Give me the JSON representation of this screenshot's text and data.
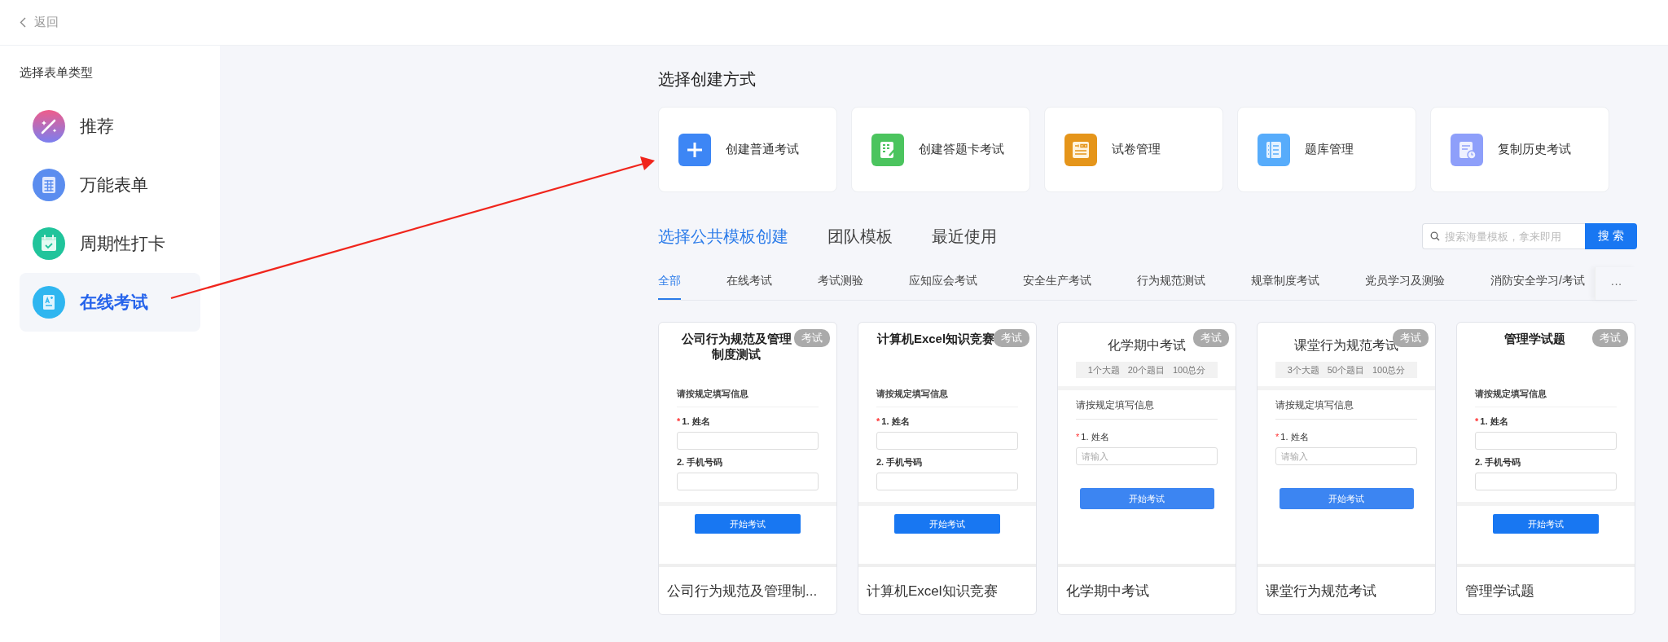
{
  "top_bar": {
    "back_label": "返回"
  },
  "sidebar": {
    "title": "选择表单类型",
    "items": [
      {
        "label": "推荐",
        "kind": "wand",
        "selected": false
      },
      {
        "label": "万能表单",
        "kind": "sheet",
        "selected": false
      },
      {
        "label": "周期性打卡",
        "kind": "calendar",
        "selected": false
      },
      {
        "label": "在线考试",
        "kind": "exam",
        "selected": true
      }
    ]
  },
  "create": {
    "title": "选择创建方式",
    "options": [
      {
        "label": "创建普通考试",
        "kind": "plus"
      },
      {
        "label": "创建答题卡考试",
        "kind": "card"
      },
      {
        "label": "试卷管理",
        "kind": "paper"
      },
      {
        "label": "题库管理",
        "kind": "bank"
      },
      {
        "label": "复制历史考试",
        "kind": "copy"
      }
    ]
  },
  "template_tabs": [
    {
      "label": "选择公共模板创建",
      "selected": true
    },
    {
      "label": "团队模板",
      "selected": false
    },
    {
      "label": "最近使用",
      "selected": false
    }
  ],
  "search": {
    "placeholder": "搜索海量模板，拿来即用",
    "button": "搜 索"
  },
  "categories": [
    {
      "label": "全部",
      "selected": true
    },
    {
      "label": "在线考试",
      "selected": false
    },
    {
      "label": "考试测验",
      "selected": false
    },
    {
      "label": "应知应会考试",
      "selected": false
    },
    {
      "label": "安全生产考试",
      "selected": false
    },
    {
      "label": "行为规范测试",
      "selected": false
    },
    {
      "label": "规章制度考试",
      "selected": false
    },
    {
      "label": "党员学习及测验",
      "selected": false
    },
    {
      "label": "消防安全学习/考试",
      "selected": false
    }
  ],
  "more": "···",
  "templates": [
    {
      "kind": "form",
      "badge": "考试",
      "heading": "公司行为规范及管理制度测试",
      "info_label": "请按规定填写信息",
      "fields": [
        {
          "mark": "*",
          "label": "1. 姓名"
        },
        {
          "label": "2. 手机号码"
        }
      ],
      "button": "开始考试",
      "title": "公司行为规范及管理制..."
    },
    {
      "kind": "form",
      "badge": "考试",
      "heading": "计算机Excel知识竞赛",
      "info_label": "请按规定填写信息",
      "fields": [
        {
          "mark": "*",
          "label": "1. 姓名"
        },
        {
          "label": "2. 手机号码"
        }
      ],
      "button": "开始考试",
      "title": "计算机Excel知识竞赛"
    },
    {
      "kind": "summary",
      "badge": "考试",
      "heading": "化学期中考试",
      "stats": [
        "1个大题",
        "20个题目",
        "100总分"
      ],
      "info_label": "请按规定填写信息",
      "fields": [
        {
          "mark": "*",
          "label": "1. 姓名",
          "placeholder": "请输入"
        }
      ],
      "button": "开始考试",
      "title": "化学期中考试"
    },
    {
      "kind": "summary",
      "badge": "考试",
      "heading": "课堂行为规范考试",
      "stats": [
        "3个大题",
        "50个题目",
        "100总分"
      ],
      "info_label": "请按规定填写信息",
      "fields": [
        {
          "mark": "*",
          "label": "1. 姓名",
          "placeholder": "请输入"
        }
      ],
      "button": "开始考试",
      "title": "课堂行为规范考试"
    },
    {
      "kind": "form",
      "badge": "考试",
      "heading": "管理学试题",
      "info_label": "请按规定填写信息",
      "fields": [
        {
          "mark": "*",
          "label": "1. 姓名"
        },
        {
          "label": "2. 手机号码"
        }
      ],
      "button": "开始考试",
      "title": "管理学试题"
    }
  ]
}
